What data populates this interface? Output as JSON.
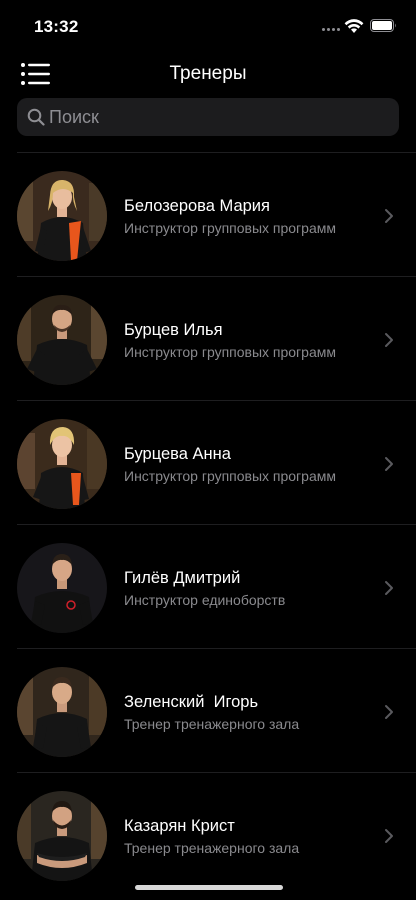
{
  "status_bar": {
    "time": "13:32"
  },
  "nav": {
    "title": "Тренеры",
    "menu_icon": "hamburger-menu-icon"
  },
  "search": {
    "placeholder": "Поиск",
    "value": "",
    "icon": "search-icon"
  },
  "trainers": [
    {
      "name": "Белозерова Мария",
      "role": "Инструктор групповых программ",
      "photo": "woman-blonde-curly",
      "shirt_accent": "#e8561c",
      "background": "#3a2a1e"
    },
    {
      "name": "Бурцев Илья",
      "role": "Инструктор групповых программ",
      "photo": "man-short-hair",
      "shirt_accent": "#1a1a1a",
      "background": "#2e2418"
    },
    {
      "name": "Бурцева Анна",
      "role": "Инструктор групповых программ",
      "photo": "woman-blonde",
      "shirt_accent": "#e8561c",
      "background": "#3b2b1c"
    },
    {
      "name": "Гилёв Дмитрий",
      "role": "Инструктор единоборств",
      "photo": "man-studio",
      "shirt_accent": "#d0202a",
      "background": "#17161a"
    },
    {
      "name": "Зеленский  Игорь",
      "role": "Тренер тренажерного зала",
      "photo": "man-arms-down",
      "shirt_accent": "#1a1a1a",
      "background": "#30261c"
    },
    {
      "name": "Казарян Крист",
      "role": "Тренер тренажерного зала",
      "photo": "man-arms-crossed",
      "shirt_accent": "#1a1a1a",
      "background": "#2a2620"
    }
  ],
  "colors": {
    "background": "#000000",
    "search_field": "#1c1c1e",
    "secondary_text": "#8a8a8e",
    "chevron": "#5a5a5e"
  }
}
